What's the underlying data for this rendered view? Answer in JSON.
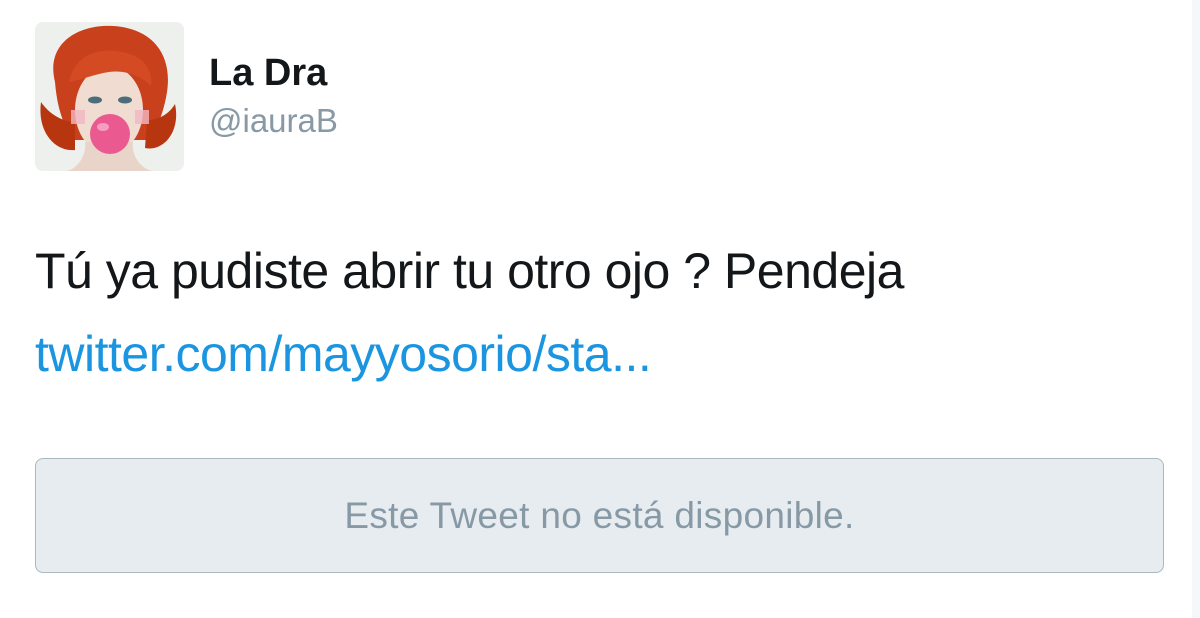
{
  "tweet": {
    "user": {
      "display_name": "La Dra",
      "handle": "@iauraB",
      "avatar_icon": "avatar-red-hair-bubblegum"
    },
    "text": "Tú ya pudiste abrir tu otro ojo ? Pendeja",
    "link_text": "twitter.com/mayyosorio/sta...",
    "quoted_tweet": {
      "unavailable_message": "Este Tweet no está disponible."
    }
  },
  "colors": {
    "link": "#1b95e0",
    "secondary_text": "#8899a6",
    "primary_text": "#14171a",
    "quote_background": "#e6ecf0",
    "quote_border": "#aab8c2"
  }
}
